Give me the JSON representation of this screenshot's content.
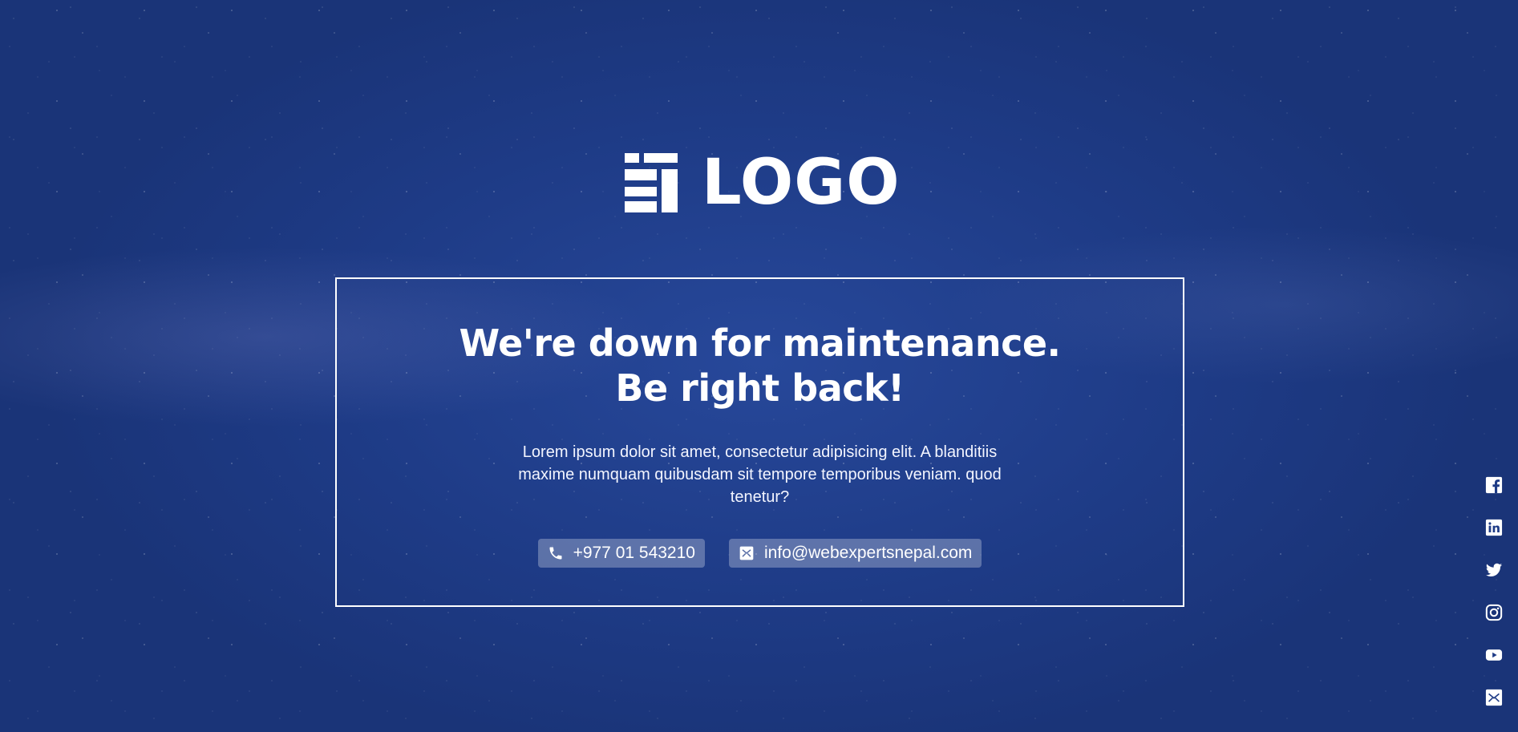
{
  "logo": {
    "text": "LOGO",
    "icon": "stacked-bars-logo-mark"
  },
  "maintenance": {
    "headline_line1": "We're down for maintenance.",
    "headline_line2": "Be right back!",
    "description": "Lorem ipsum dolor sit amet, consectetur adipisicing elit. A blanditiis maxime numquam quibusdam sit tempore temporibus veniam. quod tenetur?"
  },
  "contacts": {
    "phone": {
      "icon": "phone-icon",
      "label": "+977 01 543210"
    },
    "email": {
      "icon": "mail-icon",
      "label": "info@webexpertsnepal.com"
    }
  },
  "social": [
    {
      "icon": "facebook-icon"
    },
    {
      "icon": "linkedin-icon"
    },
    {
      "icon": "twitter-icon"
    },
    {
      "icon": "instagram-icon"
    },
    {
      "icon": "youtube-icon"
    },
    {
      "icon": "mail-icon"
    }
  ],
  "colors": {
    "background": "#1e3b86",
    "foreground": "#ffffff",
    "pill_background": "rgba(255,255,255,0.28)"
  }
}
